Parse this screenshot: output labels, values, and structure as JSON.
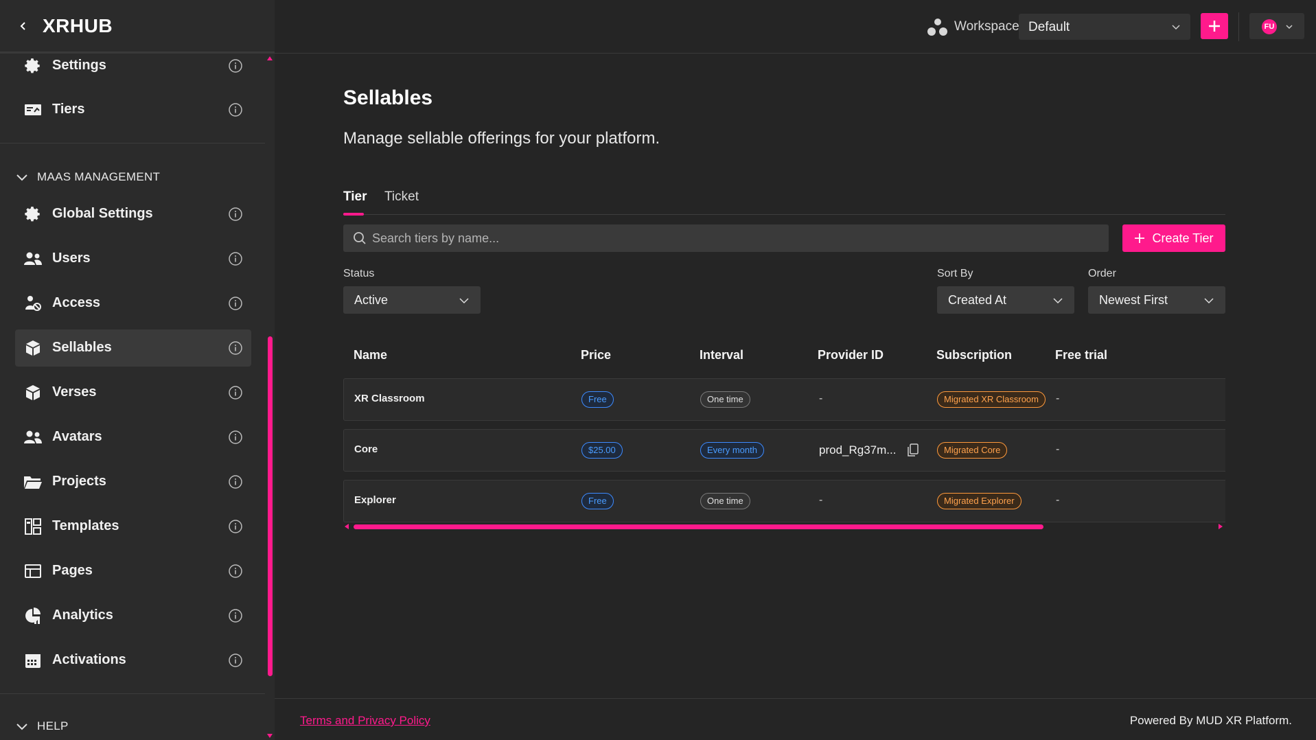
{
  "app": {
    "brand": "XRHUB"
  },
  "sidebar": {
    "top_items": [
      {
        "label": "Settings",
        "icon": "gear-icon"
      },
      {
        "label": "Tiers",
        "icon": "tiers-icon"
      }
    ],
    "section_maas": "MAAS MANAGEMENT",
    "items": [
      {
        "label": "Global Settings",
        "icon": "gear-icon"
      },
      {
        "label": "Users",
        "icon": "users-icon"
      },
      {
        "label": "Access",
        "icon": "access-icon"
      },
      {
        "label": "Sellables",
        "icon": "cube-icon",
        "active": true
      },
      {
        "label": "Verses",
        "icon": "cube-icon"
      },
      {
        "label": "Avatars",
        "icon": "users-icon"
      },
      {
        "label": "Projects",
        "icon": "folder-icon"
      },
      {
        "label": "Templates",
        "icon": "templates-icon"
      },
      {
        "label": "Pages",
        "icon": "pages-icon"
      },
      {
        "label": "Analytics",
        "icon": "analytics-icon"
      },
      {
        "label": "Activations",
        "icon": "calendar-icon"
      }
    ],
    "section_help": "HELP"
  },
  "topbar": {
    "workspace_label": "Workspace",
    "workspace_value": "Default",
    "avatar_initials": "FU"
  },
  "main": {
    "title": "Sellables",
    "subtitle": "Manage sellable offerings for your platform.",
    "tabs": [
      {
        "label": "Tier",
        "active": true
      },
      {
        "label": "Ticket"
      }
    ],
    "search_placeholder": "Search tiers by name...",
    "create_label": "Create Tier",
    "filters": {
      "status_label": "Status",
      "status_value": "Active",
      "sort_label": "Sort By",
      "sort_value": "Created At",
      "order_label": "Order",
      "order_value": "Newest First"
    },
    "table": {
      "columns": [
        "Name",
        "Price",
        "Interval",
        "Provider ID",
        "Subscription",
        "Free trial"
      ],
      "rows": [
        {
          "name": "XR Classroom",
          "price": "Free",
          "interval": "One time",
          "provider_id": "-",
          "subscription": "Migrated XR Classroom",
          "free_trial": "-"
        },
        {
          "name": "Core",
          "price": "$25.00",
          "interval": "Every month",
          "provider_id": "prod_Rg37m...",
          "subscription": "Migrated Core",
          "free_trial": "-"
        },
        {
          "name": "Explorer",
          "price": "Free",
          "interval": "One time",
          "provider_id": "-",
          "subscription": "Migrated Explorer",
          "free_trial": "-"
        }
      ]
    }
  },
  "footer": {
    "link": "Terms and Privacy Policy",
    "powered": "Powered By MUD XR Platform."
  },
  "colors": {
    "accent": "#ff1a8c",
    "price_pill": "#3d8bff",
    "subscription_pill": "#ff9a3c"
  }
}
